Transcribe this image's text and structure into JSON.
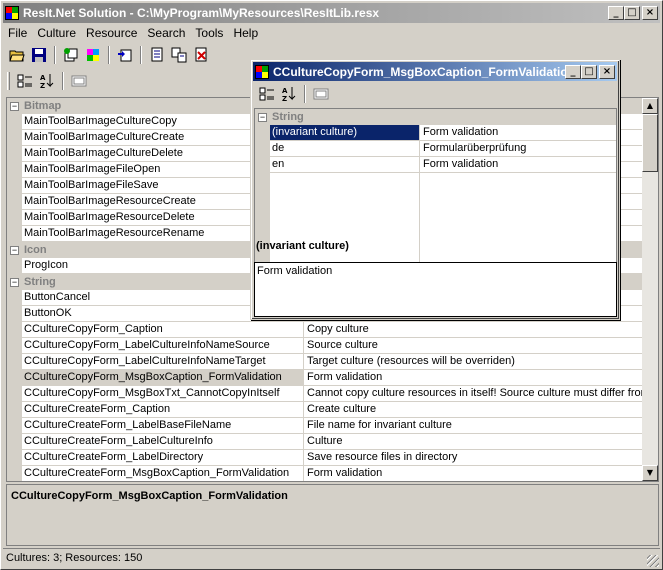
{
  "main": {
    "title": "ResIt.Net Solution - C:\\MyProgram\\MyResources\\ResItLib.resx",
    "menu": [
      "File",
      "Culture",
      "Resource",
      "Search",
      "Tools",
      "Help"
    ],
    "categories": {
      "bitmap": "Bitmap",
      "icon": "Icon",
      "string": "String"
    },
    "bitmap_rows": [
      {
        "key": "MainToolBarImageCultureCopy",
        "value": ""
      },
      {
        "key": "MainToolBarImageCultureCreate",
        "value": ""
      },
      {
        "key": "MainToolBarImageCultureDelete",
        "value": ""
      },
      {
        "key": "MainToolBarImageFileOpen",
        "value": ""
      },
      {
        "key": "MainToolBarImageFileSave",
        "value": ""
      },
      {
        "key": "MainToolBarImageResourceCreate",
        "value": ""
      },
      {
        "key": "MainToolBarImageResourceDelete",
        "value": ""
      },
      {
        "key": "MainToolBarImageResourceRename",
        "value": ""
      }
    ],
    "icon_rows": [
      {
        "key": "ProgIcon",
        "value": ""
      }
    ],
    "string_rows": [
      {
        "key": "ButtonCancel",
        "value": ""
      },
      {
        "key": "ButtonOK",
        "value": ""
      },
      {
        "key": "CCultureCopyForm_Caption",
        "value": "Copy culture"
      },
      {
        "key": "CCultureCopyForm_LabelCultureInfoNameSource",
        "value": "Source culture"
      },
      {
        "key": "CCultureCopyForm_LabelCultureInfoNameTarget",
        "value": "Target culture (resources will be overriden)"
      },
      {
        "key": "CCultureCopyForm_MsgBoxCaption_FormValidation",
        "value": "Form validation"
      },
      {
        "key": "CCultureCopyForm_MsgBoxTxt_CannotCopyInItself",
        "value": "Cannot copy culture resources in itself! Source culture must differ from ta"
      },
      {
        "key": "CCultureCreateForm_Caption",
        "value": "Create culture"
      },
      {
        "key": "CCultureCreateForm_LabelBaseFileName",
        "value": "File name for invariant culture"
      },
      {
        "key": "CCultureCreateForm_LabelCultureInfo",
        "value": "Culture"
      },
      {
        "key": "CCultureCreateForm_LabelDirectory",
        "value": "Save resource files in directory"
      },
      {
        "key": "CCultureCreateForm_MsgBoxCaption_FormValidation",
        "value": "Form validation"
      }
    ],
    "selected_index": 5,
    "description_title": "CCultureCopyForm_MsgBoxCaption_FormValidation",
    "status": "Cultures: 3; Resources: 150"
  },
  "child": {
    "title": "CCultureCopyForm_MsgBoxCaption_FormValidation",
    "category": "String",
    "rows": [
      {
        "key": "(invariant culture)",
        "value": "Form validation"
      },
      {
        "key": "de",
        "value": "Formularüberprüfung"
      },
      {
        "key": "en",
        "value": "Form validation"
      }
    ],
    "selected_label": "(invariant culture)",
    "text_value": "Form validation"
  },
  "icons": [
    "open-folder-icon",
    "save-disk-icon",
    "culture-copy-icon",
    "culture-create-icon",
    "culture-delete-icon",
    "resource-create-icon",
    "resource-rename-icon",
    "resource-delete-icon",
    "categorized-icon",
    "alphabetical-icon",
    "property-pages-icon"
  ],
  "colors": {
    "selection": "#0a246a",
    "face": "#d4d0c8",
    "category_text": "#808080"
  }
}
